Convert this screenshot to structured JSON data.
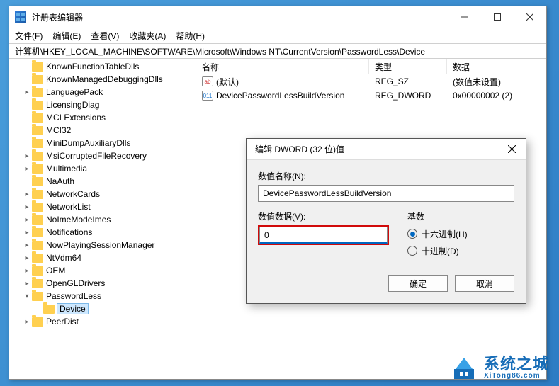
{
  "window": {
    "title": "注册表编辑器",
    "menu": [
      "文件(F)",
      "编辑(E)",
      "查看(V)",
      "收藏夹(A)",
      "帮助(H)"
    ],
    "address": "计算机\\HKEY_LOCAL_MACHINE\\SOFTWARE\\Microsoft\\Windows NT\\CurrentVersion\\PasswordLess\\Device"
  },
  "tree": {
    "items": [
      {
        "label": "KnownFunctionTableDlls",
        "caret": ""
      },
      {
        "label": "KnownManagedDebuggingDlls",
        "caret": ""
      },
      {
        "label": "LanguagePack",
        "caret": ">"
      },
      {
        "label": "LicensingDiag",
        "caret": ""
      },
      {
        "label": "MCI Extensions",
        "caret": ""
      },
      {
        "label": "MCI32",
        "caret": ""
      },
      {
        "label": "MiniDumpAuxiliaryDlls",
        "caret": ""
      },
      {
        "label": "MsiCorruptedFileRecovery",
        "caret": ">"
      },
      {
        "label": "Multimedia",
        "caret": ">"
      },
      {
        "label": "NaAuth",
        "caret": ""
      },
      {
        "label": "NetworkCards",
        "caret": ">"
      },
      {
        "label": "NetworkList",
        "caret": ">"
      },
      {
        "label": "NoImeModeImes",
        "caret": ">"
      },
      {
        "label": "Notifications",
        "caret": ">"
      },
      {
        "label": "NowPlayingSessionManager",
        "caret": ">"
      },
      {
        "label": "NtVdm64",
        "caret": ">"
      },
      {
        "label": "OEM",
        "caret": ">"
      },
      {
        "label": "OpenGLDrivers",
        "caret": ">"
      },
      {
        "label": "PasswordLess",
        "caret": "v",
        "expanded": true
      },
      {
        "label": "Device",
        "child": true,
        "selected": true
      },
      {
        "label": "PeerDist",
        "caret": ">"
      }
    ]
  },
  "list": {
    "headers": {
      "name": "名称",
      "type": "类型",
      "data": "数据"
    },
    "rows": [
      {
        "icon": "sz",
        "iconText": "ab",
        "name": "(默认)",
        "type": "REG_SZ",
        "data": "(数值未设置)"
      },
      {
        "icon": "dw",
        "iconText": "011",
        "name": "DevicePasswordLessBuildVersion",
        "type": "REG_DWORD",
        "data": "0x00000002 (2)"
      }
    ]
  },
  "dialog": {
    "title": "编辑 DWORD (32 位)值",
    "nameLabel": "数值名称(N):",
    "nameValue": "DevicePasswordLessBuildVersion",
    "dataLabel": "数值数据(V):",
    "dataValue": "0",
    "baseLabel": "基数",
    "radioHex": "十六进制(H)",
    "radioDec": "十进制(D)",
    "ok": "确定",
    "cancel": "取消"
  },
  "watermark": {
    "cn": "系统之城",
    "en": "XiTong86.com"
  }
}
